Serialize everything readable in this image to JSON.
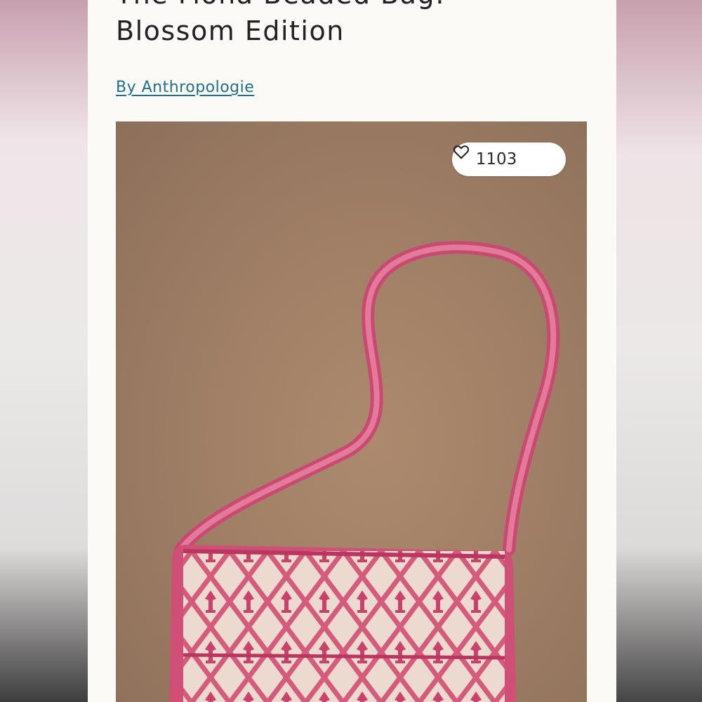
{
  "product": {
    "title_line1": "The Fiona Beaded Bag:",
    "title_line2": "Blossom Edition",
    "brand_link": "By Anthropologie",
    "like_count": "1103",
    "like_icon": "heart-outline-icon",
    "image_icon": "beaded-bag-photo"
  },
  "colors": {
    "brand_link": "#1f6f86",
    "photo_background": "#a07f66",
    "bag_pink": "#d9577f"
  }
}
